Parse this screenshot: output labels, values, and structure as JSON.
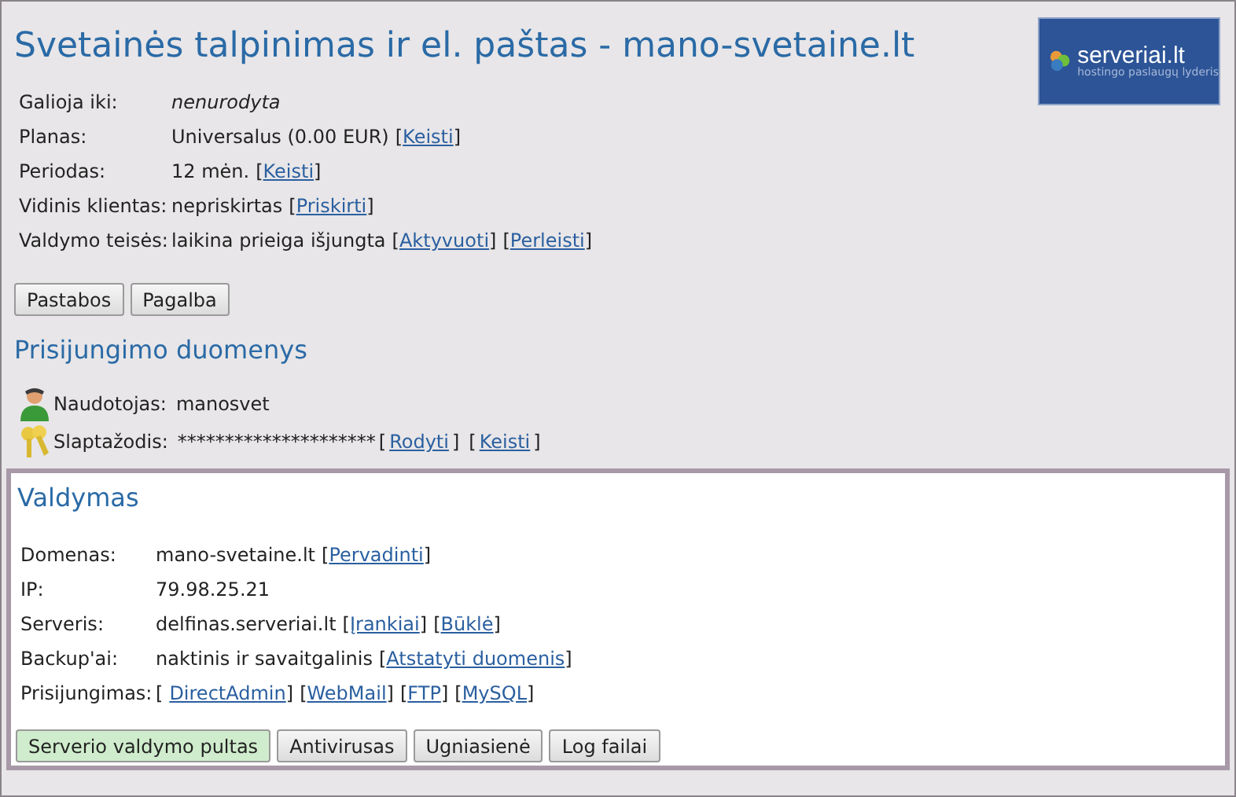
{
  "title": "Svetainės talpinimas ir el. paštas - mano-svetaine.lt",
  "logo": {
    "name": "serveriai.lt",
    "tagline": "hostingo paslaugų lyderis"
  },
  "info_rows": [
    {
      "label": "Galioja iki:",
      "value": "nenurodyta",
      "italic": true,
      "links": []
    },
    {
      "label": "Planas:",
      "value": "Universalus (0.00 EUR)",
      "italic": false,
      "links": [
        {
          "open": "[",
          "text": "Keisti",
          "close": "]"
        }
      ]
    },
    {
      "label": "Periodas:",
      "value": "12 mėn.",
      "italic": false,
      "links": [
        {
          "open": "[",
          "text": "Keisti",
          "close": "]"
        }
      ]
    },
    {
      "label": "Vidinis klientas:",
      "value": "nepriskirtas",
      "italic": false,
      "links": [
        {
          "open": "[",
          "text": "Priskirti",
          "close": "]"
        }
      ]
    },
    {
      "label": "Valdymo teisės:",
      "value": "laikina prieiga išjungta",
      "italic": false,
      "links": [
        {
          "open": "[",
          "text": "Aktyvuoti",
          "close": "]"
        },
        {
          "open": "[",
          "text": "Perleisti",
          "close": "]"
        }
      ]
    }
  ],
  "buttons": [
    {
      "label": "Pastabos",
      "highlighted": false
    },
    {
      "label": "Pagalba",
      "highlighted": false
    }
  ],
  "login": {
    "heading": "Prisijungimo duomenys",
    "rows": [
      {
        "kind": "user",
        "label": "Naudotojas:",
        "value": "manosvet",
        "links": []
      },
      {
        "kind": "password",
        "label": "Slaptažodis:",
        "value": "*********************",
        "links": [
          {
            "open": "[",
            "text": "Rodyti",
            "close": "]"
          },
          {
            "open": "[",
            "text": "Keisti",
            "close": "]"
          }
        ]
      }
    ]
  },
  "management": {
    "heading": "Valdymas",
    "rows": [
      {
        "label": "Domenas:",
        "value": "mano-svetaine.lt",
        "links": [
          {
            "open": "[",
            "text": "Pervadinti",
            "close": "]"
          }
        ]
      },
      {
        "label": "IP:",
        "value": "79.98.25.21",
        "links": []
      },
      {
        "label": "Serveris:",
        "value": "delfinas.serveriai.lt",
        "links": [
          {
            "open": "[",
            "text": "Įrankiai",
            "close": "]"
          },
          {
            "open": "[",
            "text": "Būklė",
            "close": "]"
          }
        ]
      },
      {
        "label": "Backup'ai:",
        "value": "naktinis ir savaitgalinis",
        "links": [
          {
            "open": "[",
            "text": "Atstatyti duomenis",
            "close": "]"
          }
        ]
      },
      {
        "label": "Prisijungimas:",
        "links": [
          {
            "open": "[",
            "text": "DirectAdmin",
            "close": "]"
          },
          {
            "open": "[",
            "text": "WebMail",
            "close": "]"
          },
          {
            "open": "[",
            "text": "FTP",
            "close": "]"
          },
          {
            "open": "[",
            "text": "MySQL",
            "close": "]"
          }
        ]
      }
    ],
    "buttons": [
      {
        "label": "Serverio valdymo pultas",
        "highlighted": true
      },
      {
        "label": "Antivirusas",
        "highlighted": false
      },
      {
        "label": "Ugniasienė",
        "highlighted": false
      },
      {
        "label": "Log failai",
        "highlighted": false
      }
    ]
  }
}
